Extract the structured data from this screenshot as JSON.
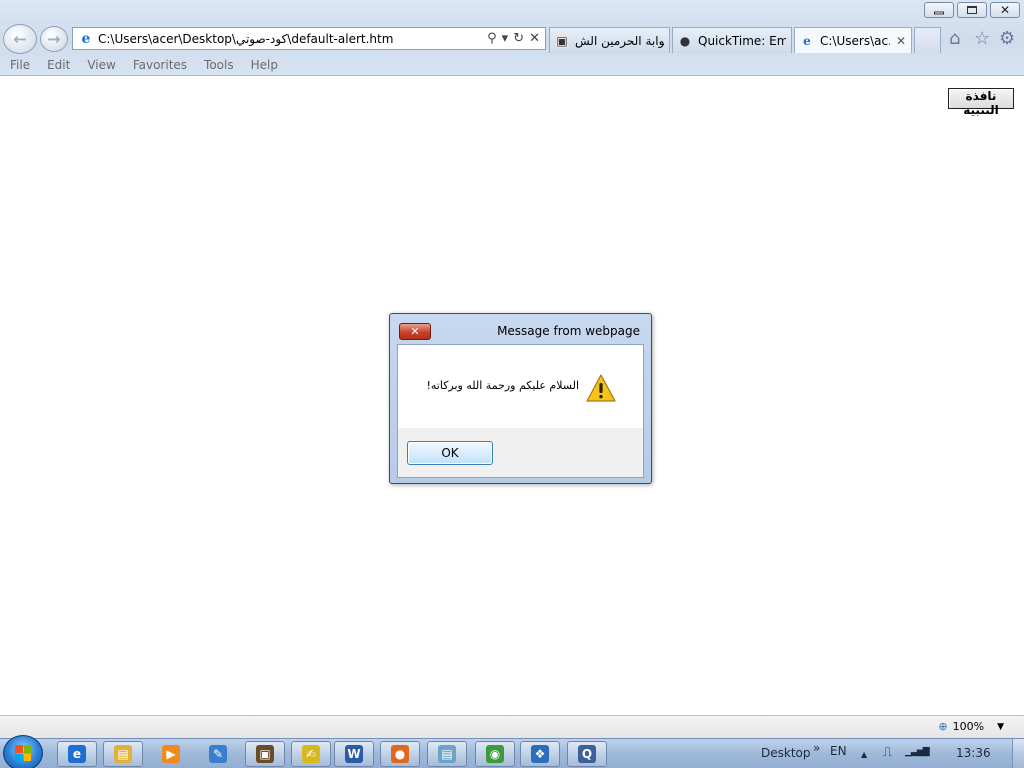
{
  "window": {
    "controls": {
      "minimize_icon": "minimize-icon",
      "restore_icon": "restore-icon",
      "close_glyph": "✕"
    }
  },
  "address_bar": {
    "url": "C:\\Users\\acer\\Desktop\\كود-صوتي\\default-alert.htm",
    "icons": [
      "ie-page-icon",
      "search-icon",
      "dropdown-icon",
      "refresh-icon",
      "stop-icon"
    ],
    "search_glyph": "⚲",
    "dropdown_glyph": "▾",
    "refresh_glyph": "↻",
    "stop_glyph": "✕"
  },
  "nav": {
    "back_glyph": "←",
    "forward_glyph": "→"
  },
  "tabs": [
    {
      "title": "بوابة الحرمين الش...",
      "icon": "haramain-site-icon",
      "active": false
    },
    {
      "title": "QuickTime: Em...",
      "icon": "apple-icon",
      "active": false
    },
    {
      "title": "C:\\Users\\ac...",
      "icon": "ie-page-icon",
      "active": true,
      "close_glyph": "✕"
    }
  ],
  "command_icons": {
    "home": "⌂",
    "favorites": "☆",
    "tools": "⚙"
  },
  "menu": [
    "File",
    "Edit",
    "View",
    "Favorites",
    "Tools",
    "Help"
  ],
  "page": {
    "button_label": "نافذة التنبيه"
  },
  "dialog": {
    "title": "Message from webpage",
    "close_glyph": "✕",
    "message": "السلام عليكم ورحمة الله وبركاته!",
    "icon": "warning-icon",
    "ok_label": "OK"
  },
  "status_bar": {
    "zoom_label": "100%",
    "zoom_icon": "zoom-icon",
    "caret": "▼"
  },
  "taskbar": {
    "pinned": [
      {
        "name": "internet-explorer",
        "boxed": true,
        "color": "#1f6fd1",
        "glyph": "e"
      },
      {
        "name": "file-explorer",
        "boxed": true,
        "color": "#e0b13c",
        "glyph": "▤"
      },
      {
        "name": "media-player",
        "boxed": false,
        "color": "#f08a1c",
        "glyph": "▶"
      },
      {
        "name": "paint",
        "boxed": false,
        "color": "#3a7fcf",
        "glyph": "✎"
      },
      {
        "name": "photo-app",
        "boxed": true,
        "color": "#6b4b2a",
        "glyph": "▣"
      },
      {
        "name": "ink-tool",
        "boxed": true,
        "color": "#d6b81f",
        "glyph": "✍"
      },
      {
        "name": "microsoft-word",
        "boxed": true,
        "color": "#2b5aa6",
        "glyph": "W"
      },
      {
        "name": "firefox",
        "boxed": true,
        "color": "#e2661d",
        "glyph": "●"
      },
      {
        "name": "notepad",
        "boxed": true,
        "color": "#6da3c7",
        "glyph": "▤"
      },
      {
        "name": "google-chrome",
        "boxed": true,
        "color": "#3c9b3c",
        "glyph": "◉"
      },
      {
        "name": "feedback-app",
        "boxed": true,
        "color": "#2a6fb8",
        "glyph": "❖"
      },
      {
        "name": "quicktime",
        "boxed": true,
        "color": "#3d5f9a",
        "glyph": "Q"
      }
    ],
    "tray": {
      "desktop_label": "Desktop",
      "chevron": "»",
      "language": "EN",
      "clock": "13:36",
      "icons": [
        "tray-up-arrow-icon",
        "power-icon",
        "network-signal-icon"
      ],
      "up_glyph": "▲",
      "power_glyph": "⎍",
      "signal_glyph": "▁▃▅▇"
    }
  },
  "colors": {
    "chrome_bg": "#d3dfee",
    "dialog_frame": "#bcd0e9",
    "close_red": "#c8422b",
    "taskbar_blue": "#a3bddc",
    "warning_yellow": "#f7c21a"
  }
}
